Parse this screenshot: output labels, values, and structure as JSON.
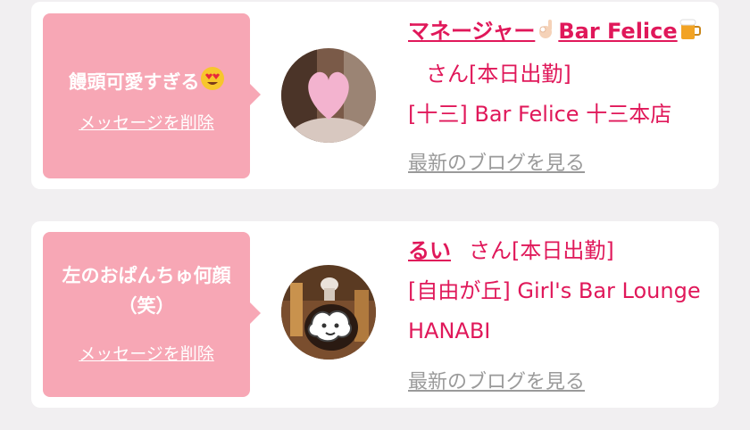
{
  "items": [
    {
      "message": "饅頭可愛すぎる",
      "delete_label": "メッセージを削除",
      "name": "マネージャー",
      "name_suffix": "Bar Felice",
      "honorific": "さん",
      "status": "[本日出勤]",
      "shop": "[十三] Bar Felice 十三本店",
      "blog_link": "最新のブログを見る",
      "icons": [
        "heart-eyes-emoji-icon",
        "ok-hand-emoji-icon",
        "beer-mug-emoji-icon"
      ]
    },
    {
      "message": "左のおぱんちゅ何顔（笑）",
      "delete_label": "メッセージを削除",
      "name": "るい",
      "honorific": "さん",
      "status": "[本日出勤]",
      "shop": "[自由が丘] Girl's Bar Lounge HANABI",
      "blog_link": "最新のブログを見る"
    }
  ],
  "colors": {
    "accent": "#e0185a",
    "bubble": "#f7a7b5",
    "link_gray": "#9a9a9a",
    "background": "#f1eff1"
  }
}
